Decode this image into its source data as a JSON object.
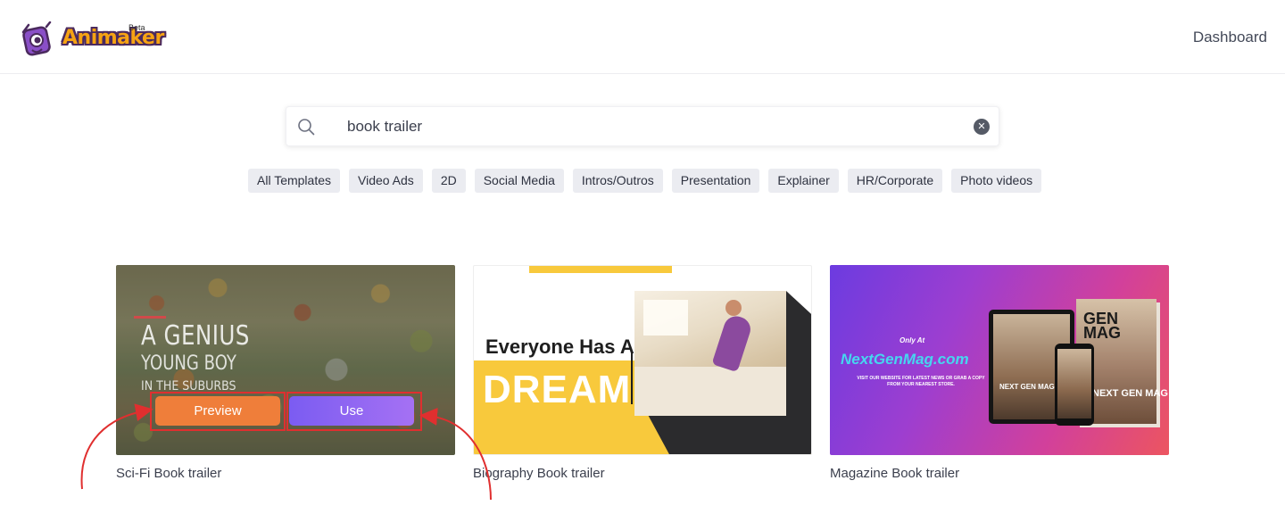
{
  "header": {
    "logo_text": "Animaker",
    "logo_badge": "Beta",
    "dashboard_label": "Dashboard"
  },
  "search": {
    "value": "book trailer",
    "placeholder": "Search templates"
  },
  "filters": [
    "All Templates",
    "Video Ads",
    "2D",
    "Social Media",
    "Intros/Outros",
    "Presentation",
    "Explainer",
    "HR/Corporate",
    "Photo videos"
  ],
  "cards": [
    {
      "title": "Sci-Fi Book trailer",
      "thumb_lines": [
        "A GENIUS",
        "YOUNG BOY",
        "IN THE SUBURBS"
      ],
      "preview_label": "Preview",
      "use_label": "Use"
    },
    {
      "title": "Biography Book trailer",
      "thumb_lines": [
        "Everyone Has A",
        "DREAM"
      ]
    },
    {
      "title": "Magazine Book trailer",
      "thumb_lines": [
        "Only At",
        "NextGenMag.com",
        "VISIT OUR WEBSITE FOR LATEST NEWS OR GRAB A COPY FROM YOUR NEAREST STORE.",
        "NEXT GEN MAG",
        "GEN MAG",
        "NEXT GEN MAG"
      ]
    }
  ],
  "colors": {
    "preview_button": "#ef7e3a",
    "use_button_start": "#7b5cf2",
    "use_button_end": "#a571f3",
    "annotation": "#e02f2f"
  }
}
